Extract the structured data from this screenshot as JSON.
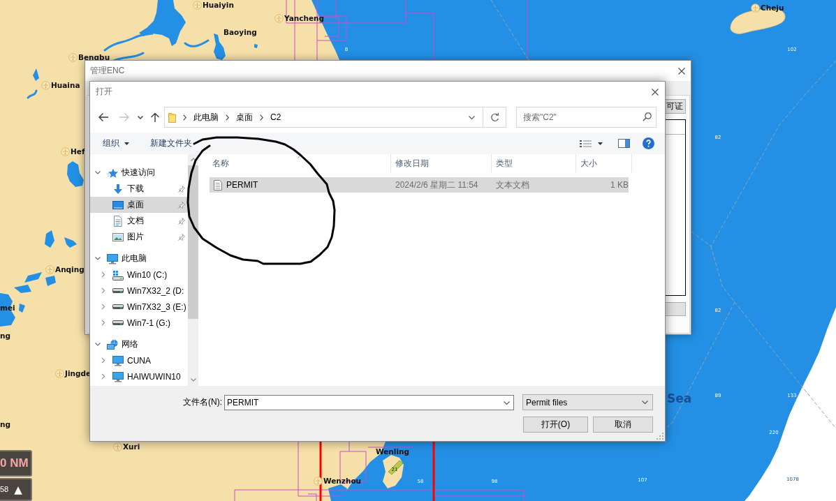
{
  "chart": {
    "places": [
      {
        "name": "Huaiyin",
        "kind": "airport"
      },
      {
        "name": "Yancheng",
        "kind": "airport"
      },
      {
        "name": "Baoying",
        "kind": "plain"
      },
      {
        "name": "Bengbu",
        "kind": "airport"
      },
      {
        "name": "Huaina",
        "kind": "airport"
      },
      {
        "name": "Hef",
        "kind": "airport"
      },
      {
        "name": "Anqing",
        "kind": "airport"
      },
      {
        "name": "mei",
        "kind": "plain"
      },
      {
        "name": "ng",
        "kind": "plain"
      },
      {
        "name": "Jingde",
        "kind": "airport"
      },
      {
        "name": "ng",
        "kind": "plain"
      },
      {
        "name": "Xuri",
        "kind": "airport"
      },
      {
        "name": "Wenling",
        "kind": "plain"
      },
      {
        "name": "Wenzhou",
        "kind": "airport"
      },
      {
        "name": "Cheju",
        "kind": "airport"
      }
    ],
    "sea_name": "Sea",
    "soundings": [
      "8",
      "102",
      "82",
      "82",
      "89",
      "133",
      "220",
      "1078",
      "58",
      "98",
      "107",
      "21"
    ],
    "scale": {
      "distance": "0 NM"
    },
    "heading": {
      "value": "58",
      "arrow": "▲"
    }
  },
  "manage_window": {
    "title": "管理ENC",
    "button": "可证"
  },
  "open_dialog": {
    "title": "打开",
    "nav": [
      {
        "kind": "back",
        "disabled": false
      },
      {
        "kind": "forward",
        "disabled": true
      },
      {
        "kind": "recent",
        "disabled": false
      },
      {
        "kind": "up",
        "disabled": false
      }
    ],
    "path": [
      "此电脑",
      "桌面",
      "C2"
    ],
    "search": {
      "placeholder": "搜索\"C2\""
    },
    "toolbar": [
      {
        "label": "组织",
        "kind": "menu"
      },
      {
        "label": "新建文件夹",
        "kind": "plain"
      }
    ],
    "tree": [
      {
        "label": "快速访问",
        "kind": "star",
        "expanded": true,
        "selected": false,
        "children": [
          {
            "label": "下载",
            "kind": "download",
            "pinned": true,
            "selected": false
          },
          {
            "label": "桌面",
            "kind": "desktop",
            "pinned": true,
            "selected": true
          },
          {
            "label": "文档",
            "kind": "document",
            "pinned": true,
            "selected": false
          },
          {
            "label": "图片",
            "kind": "picture",
            "pinned": true,
            "selected": false
          }
        ]
      },
      {
        "label": "此电脑",
        "kind": "computer",
        "expanded": true,
        "selected": false,
        "children": [
          {
            "label": "Win10 (C:)",
            "kind": "system-drive",
            "expanded": false,
            "selected": false
          },
          {
            "label": "Win7X32_2 (D:",
            "kind": "drive",
            "expanded": false,
            "selected": false
          },
          {
            "label": "Win7X32_3 (E:)",
            "kind": "drive",
            "expanded": false,
            "selected": false
          },
          {
            "label": "Win7-1 (G:)",
            "kind": "drive",
            "expanded": false,
            "selected": false
          }
        ]
      },
      {
        "label": "网络",
        "kind": "network",
        "expanded": true,
        "selected": false,
        "children": [
          {
            "label": "CUNA",
            "kind": "pc",
            "expanded": false,
            "selected": false
          },
          {
            "label": "HAIWUWIN10",
            "kind": "pc",
            "expanded": false,
            "selected": false
          }
        ]
      }
    ],
    "columns": [
      {
        "label": "名称",
        "sorted": true
      },
      {
        "label": "修改日期",
        "sorted": false
      },
      {
        "label": "类型",
        "sorted": false
      },
      {
        "label": "大小",
        "sorted": false
      }
    ],
    "files": [
      {
        "name": "PERMIT",
        "modified": "2024/2/6 星期二 11:54",
        "type": "文本文档",
        "size": "1 KB",
        "selected": true
      }
    ],
    "file_name": {
      "label": "文件名(N):",
      "value": "PERMIT"
    },
    "file_type": "Permit files",
    "buttons": [
      "打开(O)",
      "取消"
    ]
  }
}
